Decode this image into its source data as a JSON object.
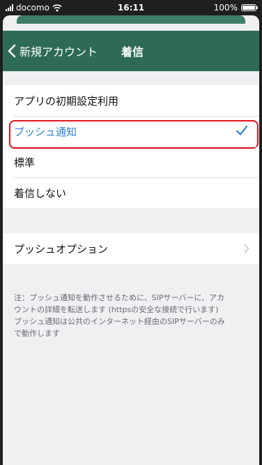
{
  "status_bar": {
    "carrier": "docomo",
    "time": "16:11",
    "battery": "100%"
  },
  "nav": {
    "back_label": "新規アカウント",
    "title": "着信"
  },
  "options": [
    {
      "label": "アプリの初期設定利用",
      "selected": false
    },
    {
      "label": "プッシュ通知",
      "selected": true
    },
    {
      "label": "標準",
      "selected": false
    },
    {
      "label": "着信しない",
      "selected": false
    }
  ],
  "push_options": {
    "label": "プッシュオプション"
  },
  "note": {
    "line1": "注：プッシュ通知を動作させるために、SIPサーバーに、アカ",
    "line2": "ウントの詳細を転送します (httpsの安全な接続で行います)",
    "line3": "プッシュ通知は公共のインターネット経由のSIPサーバーのみ",
    "line4": "で動作します"
  },
  "colors": {
    "nav_background": "#2e6b57",
    "selected_text": "#2f7fd6",
    "highlight_border": "#e0141c",
    "page_background": "#f0f0f3"
  },
  "icons": {
    "back": "chevron-left-icon",
    "check": "checkmark-icon",
    "disclosure": "chevron-right-icon"
  }
}
